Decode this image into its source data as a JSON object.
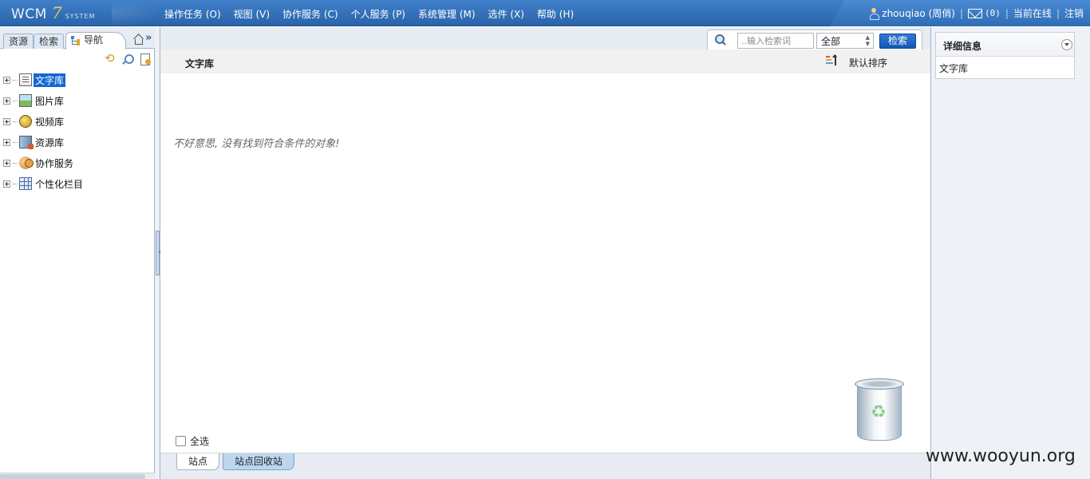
{
  "logo": {
    "brand": "WCM",
    "version": "7",
    "subtitle": "SYSTEM"
  },
  "menu": [
    {
      "label": "操作任务 (O)"
    },
    {
      "label": "视图 (V)"
    },
    {
      "label": "协作服务 (C)"
    },
    {
      "label": "个人服务 (P)"
    },
    {
      "label": "系统管理 (M)"
    },
    {
      "label": "选件 (X)"
    },
    {
      "label": "帮助 (H)"
    }
  ],
  "user": {
    "name": "zhouqiao (周俏)",
    "mail_count": "(0)",
    "online_label": "当前在线",
    "logout_label": "注销"
  },
  "left": {
    "tabs": {
      "resource": "资源",
      "search": "检索",
      "navigation": "导航"
    },
    "tree": [
      {
        "label": "文字库",
        "icon": "doc-library-icon",
        "selected": true
      },
      {
        "label": "图片库",
        "icon": "picture-library-icon"
      },
      {
        "label": "视频库",
        "icon": "video-library-icon"
      },
      {
        "label": "资源库",
        "icon": "resource-library-icon"
      },
      {
        "label": "协作服务",
        "icon": "collaboration-icon"
      },
      {
        "label": "个性化栏目",
        "icon": "custom-column-icon"
      }
    ]
  },
  "search": {
    "placeholder": "..输入检索词",
    "scope": "全部",
    "button": "检索"
  },
  "list": {
    "title": "文字库",
    "sort_label": "默认排序",
    "empty_message": "不好意思, 没有找到符合条件的对象!",
    "select_all": "全选"
  },
  "bottom_tabs": {
    "site": "站点",
    "recycle": "站点回收站"
  },
  "detail": {
    "title": "详细信息",
    "value": "文字库"
  },
  "watermark": "www.wooyun.org",
  "colors": {
    "topbar": "#2f6cb3",
    "selected": "#1467d4",
    "search_button": "#1458b5"
  }
}
